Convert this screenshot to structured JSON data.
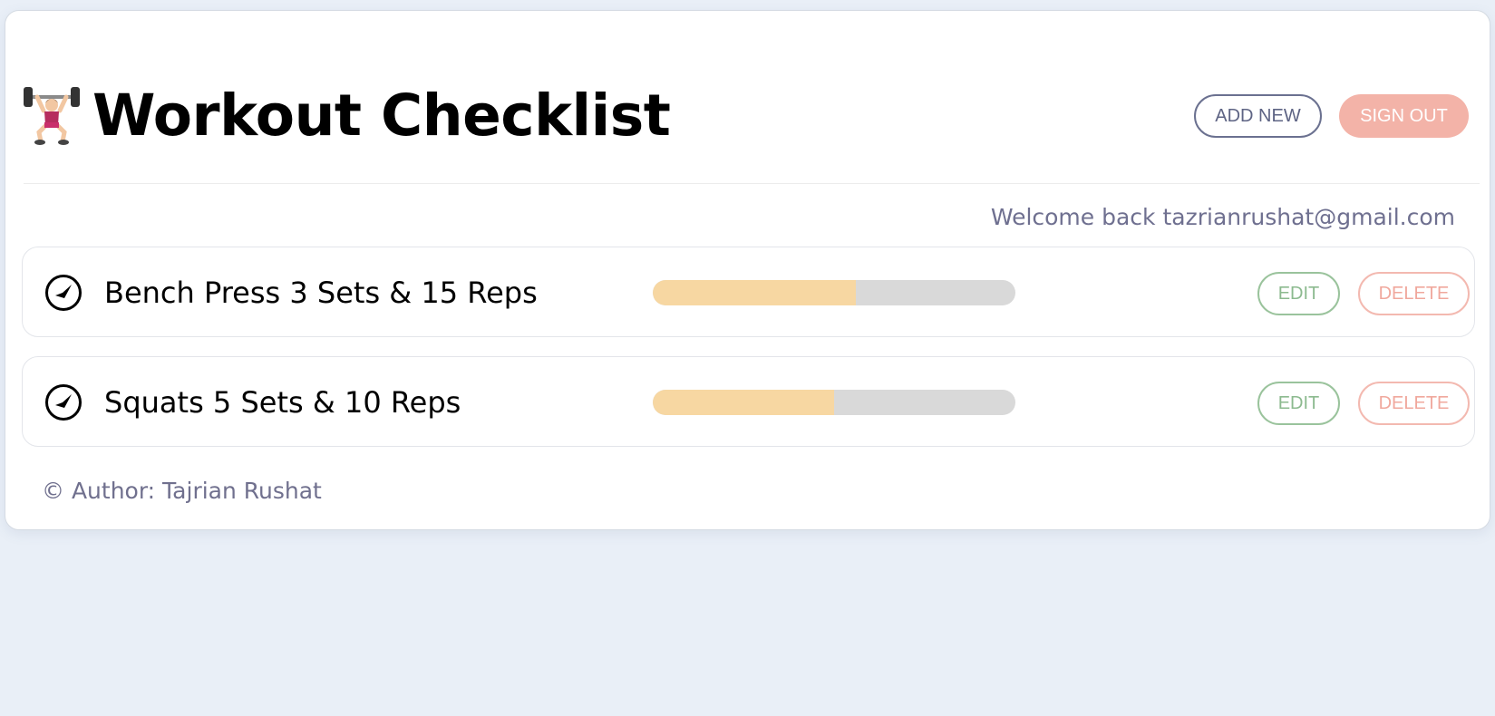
{
  "header": {
    "title": "Workout Checklist",
    "title_icon": "weightlifter-emoji-icon",
    "add_new_label": "ADD NEW",
    "sign_out_label": "SIGN OUT"
  },
  "welcome": {
    "text": "Welcome back tazrianrushat@gmail.com"
  },
  "workouts": [
    {
      "label": "Bench Press 3 Sets & 15 Reps",
      "icon": "check-circle-icon",
      "progress_fraction": 0.56,
      "edit_label": "EDIT",
      "delete_label": "DELETE"
    },
    {
      "label": "Squats 5 Sets & 10 Reps",
      "icon": "check-circle-icon",
      "progress_fraction": 0.5,
      "edit_label": "EDIT",
      "delete_label": "DELETE"
    }
  ],
  "footer": {
    "text": "© Author: Tajrian Rushat"
  },
  "colors": {
    "background": "#e9eff7",
    "progress_fill": "#f7d7a2",
    "progress_track": "#d9d9d9",
    "sign_out_bg": "#f3b3a8",
    "edit_border": "#9ac39c",
    "delete_border": "#f3b9b0",
    "add_new_border": "#6b7190"
  }
}
